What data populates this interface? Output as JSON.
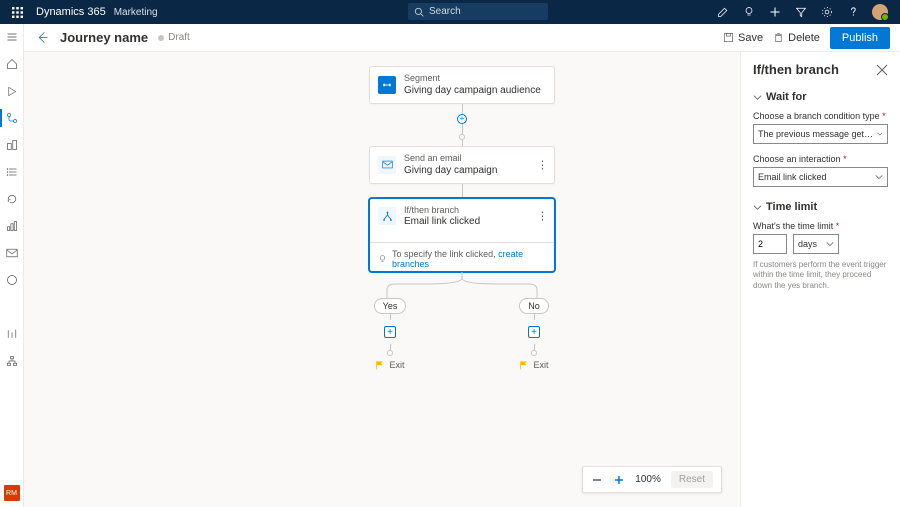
{
  "topbar": {
    "brand": "Dynamics 365",
    "module": "Marketing",
    "search_placeholder": "Search"
  },
  "cmdbar": {
    "title": "Journey name",
    "status": "Draft",
    "save": "Save",
    "delete": "Delete",
    "publish": "Publish"
  },
  "flow": {
    "segment": {
      "type": "Segment",
      "title": "Giving day campaign audience"
    },
    "email": {
      "type": "Send an email",
      "title": "Giving day campaign"
    },
    "branch": {
      "type": "If/then branch",
      "title": "Email link clicked",
      "hint_prefix": "To specify the link clicked, ",
      "hint_link": "create branches"
    },
    "yes": "Yes",
    "no": "No",
    "exit": "Exit"
  },
  "panel": {
    "title": "If/then branch",
    "section_wait": "Wait for",
    "cond_label": "Choose a branch condition type",
    "cond_value": "The previous message gets an interaction",
    "inter_label": "Choose an interaction",
    "inter_value": "Email link clicked",
    "section_time": "Time limit",
    "time_label": "What's the time limit",
    "time_value": "2",
    "time_unit": "days",
    "time_help": "If customers perform the event trigger within the time limit, they proceed down the yes branch."
  },
  "zoom": {
    "level": "100%",
    "reset": "Reset"
  },
  "sidebar": {
    "rm": "RM"
  }
}
